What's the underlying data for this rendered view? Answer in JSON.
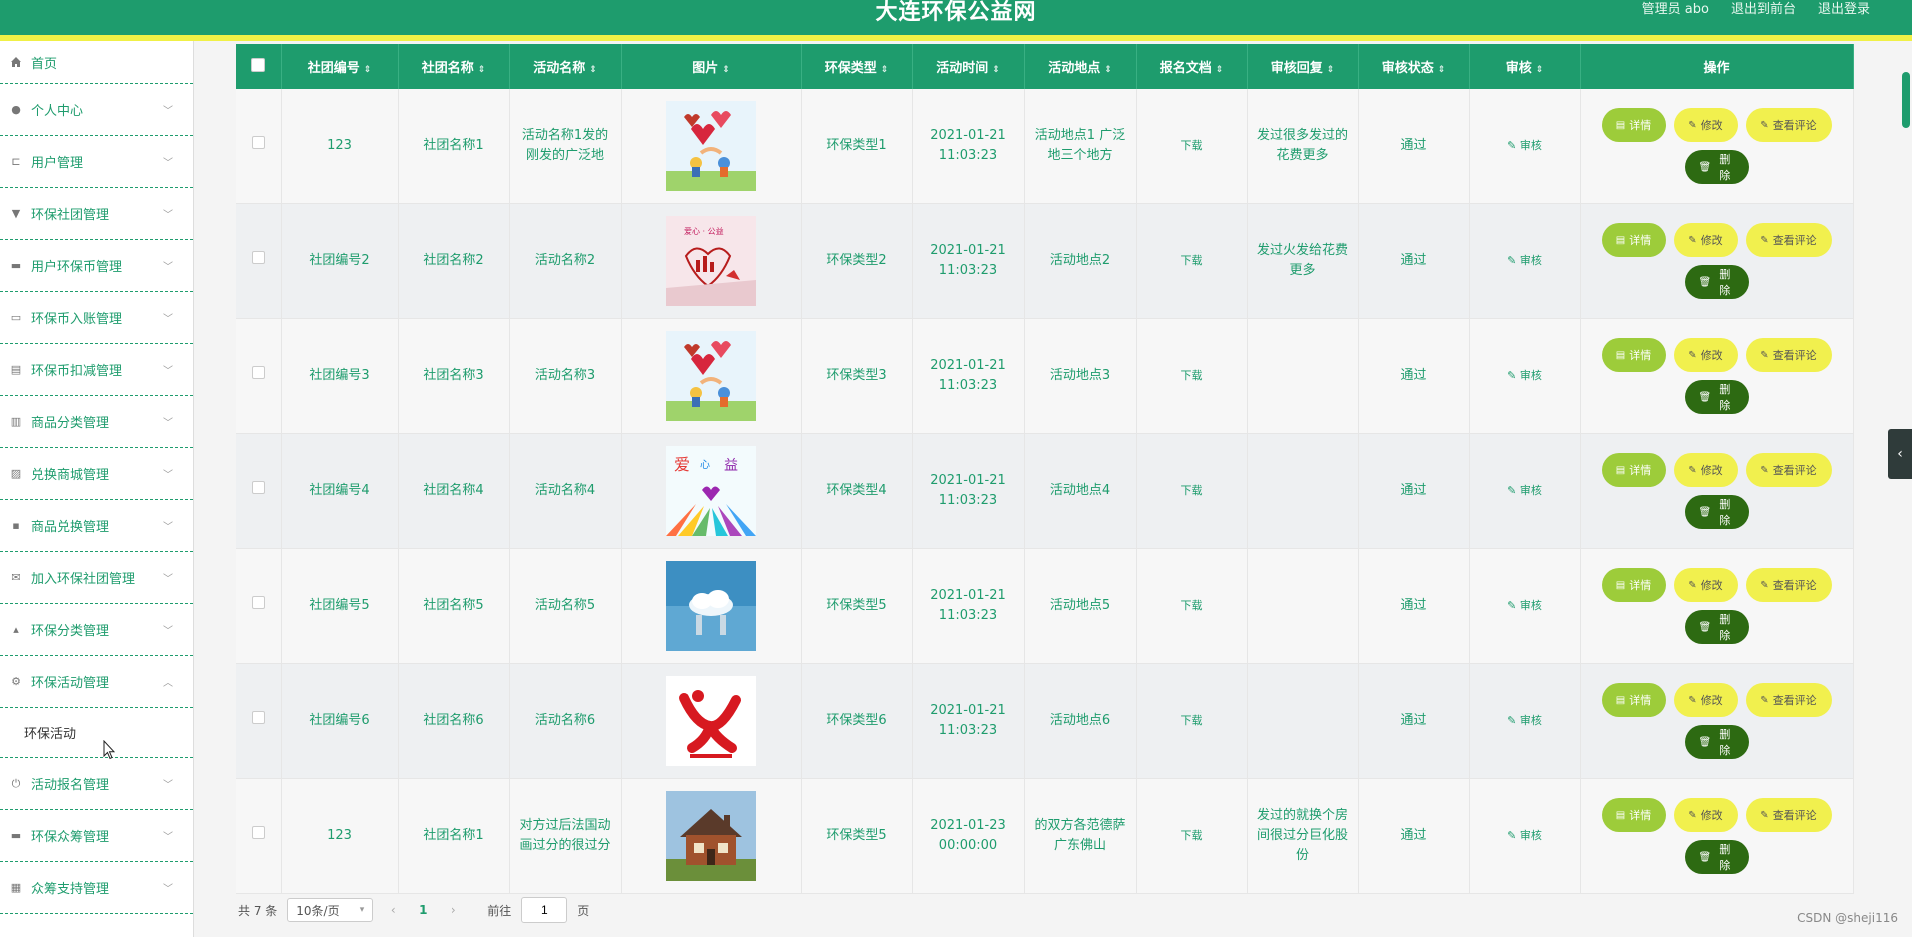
{
  "header": {
    "title": "大连环保公益网",
    "admin_label": "管理员 abo",
    "to_front_label": "退出到前台",
    "logout_label": "退出登录"
  },
  "sidebar": {
    "home": "首页",
    "items": [
      {
        "label": "个人中心",
        "icon": "user-icon"
      },
      {
        "label": "用户管理",
        "icon": "crop-icon"
      },
      {
        "label": "环保社团管理",
        "icon": "stamp-icon"
      },
      {
        "label": "用户环保币管理",
        "icon": "printer-icon"
      },
      {
        "label": "环保币入账管理",
        "icon": "card-icon"
      },
      {
        "label": "环保币扣减管理",
        "icon": "clipboard-icon"
      },
      {
        "label": "商品分类管理",
        "icon": "bars-icon"
      },
      {
        "label": "兑换商城管理",
        "icon": "chart-icon"
      },
      {
        "label": "商品兑换管理",
        "icon": "chat-icon"
      },
      {
        "label": "加入环保社团管理",
        "icon": "mail-icon"
      },
      {
        "label": "环保分类管理",
        "icon": "thumb-icon"
      },
      {
        "label": "环保活动管理",
        "icon": "gear-icon"
      }
    ],
    "active_sub": "环保活动",
    "items_after": [
      {
        "label": "活动报名管理",
        "icon": "power-icon"
      },
      {
        "label": "环保众筹管理",
        "icon": "monitor-icon"
      },
      {
        "label": "众筹支持管理",
        "icon": "grid-icon"
      }
    ]
  },
  "table": {
    "headers": [
      "社团编号",
      "社团名称",
      "活动名称",
      "图片",
      "环保类型",
      "活动时间",
      "活动地点",
      "报名文档",
      "审核回复",
      "审核状态",
      "审核",
      "操作"
    ],
    "rows": [
      {
        "code": "123",
        "club": "社团名称1",
        "name": "活动名称1发的刚发的广泛地",
        "type": "环保类型1",
        "time": "2021-01-21 11:03:23",
        "place": "活动地点1 广泛地三个地方",
        "doc": "下载",
        "reply": "发过很多发过的花费更多",
        "status": "通过",
        "thumb": "hearts"
      },
      {
        "code": "社团编号2",
        "club": "社团名称2",
        "name": "活动名称2",
        "type": "环保类型2",
        "time": "2021-01-21 11:03:23",
        "place": "活动地点2",
        "doc": "下载",
        "reply": "发过火发给花费更多",
        "status": "通过",
        "thumb": "pink"
      },
      {
        "code": "社团编号3",
        "club": "社团名称3",
        "name": "活动名称3",
        "type": "环保类型3",
        "time": "2021-01-21 11:03:23",
        "place": "活动地点3",
        "doc": "下载",
        "reply": "",
        "status": "通过",
        "thumb": "hearts"
      },
      {
        "code": "社团编号4",
        "club": "社团名称4",
        "name": "活动名称4",
        "type": "环保类型4",
        "time": "2021-01-21 11:03:23",
        "place": "活动地点4",
        "doc": "下载",
        "reply": "",
        "status": "通过",
        "thumb": "colorful"
      },
      {
        "code": "社团编号5",
        "club": "社团名称5",
        "name": "活动名称5",
        "type": "环保类型5",
        "time": "2021-01-21 11:03:23",
        "place": "活动地点5",
        "doc": "下载",
        "reply": "",
        "status": "通过",
        "thumb": "sky"
      },
      {
        "code": "社团编号6",
        "club": "社团名称6",
        "name": "活动名称6",
        "type": "环保类型6",
        "time": "2021-01-21 11:03:23",
        "place": "活动地点6",
        "doc": "下载",
        "reply": "",
        "status": "通过",
        "thumb": "logo"
      },
      {
        "code": "123",
        "club": "社团名称1",
        "name": "对方过后法国动画过分的很过分",
        "type": "环保类型5",
        "time": "2021-01-23 00:00:00",
        "place": "的双方各范德萨广东佛山",
        "doc": "下载",
        "reply": "发过的就换个房间很过分巨化股份",
        "status": "通过",
        "thumb": "house"
      }
    ],
    "audit_label": "审核",
    "buttons": {
      "detail": "详情",
      "edit": "修改",
      "comment": "查看评论",
      "delete": "删除"
    }
  },
  "pagination": {
    "total_label": "共 7 条",
    "page_size": "10条/页",
    "current_page": "1",
    "goto_label": "前往",
    "goto_value": "1",
    "page_suffix": "页"
  },
  "watermark": "CSDN @sheji116"
}
